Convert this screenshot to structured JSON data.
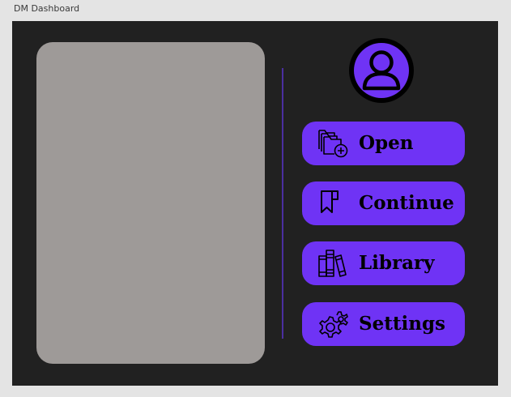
{
  "window": {
    "title": "DM Dashboard"
  },
  "colors": {
    "canvas_bg": "#212121",
    "preview_panel": "#9e9a98",
    "accent": "#6f33f5",
    "divider": "#4b2fa0",
    "text": "#000000"
  },
  "profile": {
    "icon": "user-avatar-icon"
  },
  "menu": {
    "items": [
      {
        "label": "Open",
        "icon": "folder-add-icon"
      },
      {
        "label": "Continue",
        "icon": "bookmark-icon"
      },
      {
        "label": "Library",
        "icon": "books-icon"
      },
      {
        "label": "Settings",
        "icon": "gears-icon"
      }
    ]
  }
}
